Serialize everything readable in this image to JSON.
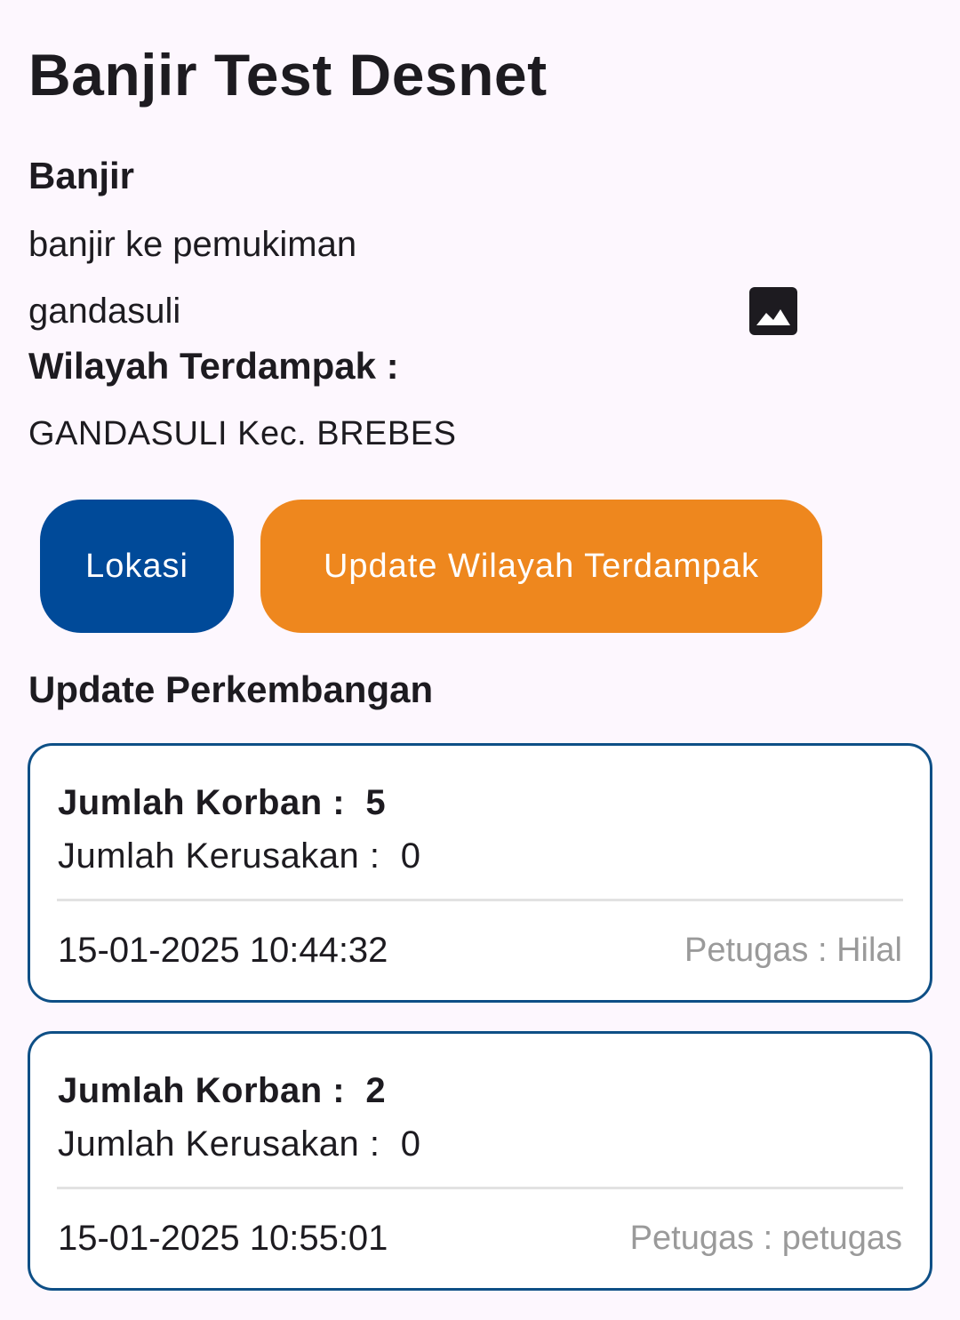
{
  "header": {
    "title": "Banjir Test Desnet"
  },
  "event": {
    "type": "Banjir",
    "description": "banjir ke pemukiman",
    "location": "gandasuli",
    "image_icon": "image-icon"
  },
  "affected": {
    "label": "Wilayah Terdampak :",
    "value": "GANDASULI Kec. BREBES"
  },
  "buttons": {
    "location_label": "Lokasi",
    "update_label": "Update Wilayah Terdampak",
    "location_color": "#004a99",
    "update_color": "#ee871e"
  },
  "updates": {
    "section_title": "Update Perkembangan",
    "items": [
      {
        "victims_label": "Jumlah Korban :",
        "victims_value": "5",
        "damage_label": "Jumlah Kerusakan :",
        "damage_value": "0",
        "timestamp": "15-01-2025 10:44:32",
        "officer": "Petugas : Hilal"
      },
      {
        "victims_label": "Jumlah Korban :",
        "victims_value": "2",
        "damage_label": "Jumlah Kerusakan :",
        "damage_value": "0",
        "timestamp": "15-01-2025 10:55:01",
        "officer": "Petugas : petugas"
      }
    ]
  }
}
